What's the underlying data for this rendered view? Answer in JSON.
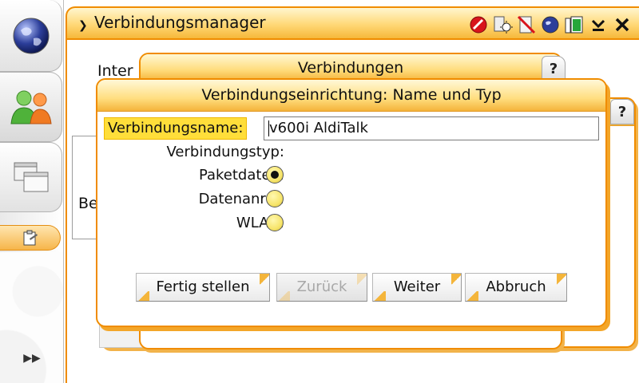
{
  "app": {
    "title": "Verbindungsmanager",
    "partial_label_top": "Inter",
    "partial_label_left": "Be"
  },
  "status_icons": [
    "stop-icon",
    "settings-sun-icon",
    "no-sim-icon",
    "globe-icon",
    "battery-icon"
  ],
  "window_controls": [
    "minimize-icon",
    "close-icon"
  ],
  "sidebar": {
    "items": [
      {
        "icon": "globe-icon"
      },
      {
        "icon": "contacts-icon"
      },
      {
        "icon": "windows-icon"
      },
      {
        "icon": "clipboard-icon"
      }
    ],
    "more_label": "▶▶"
  },
  "background_dialog": {
    "title": "Verbindungen",
    "help_label": "?"
  },
  "dialog": {
    "title": "Verbindungseinrichtung: Name und Typ",
    "name_label": "Verbindungsname:",
    "name_value": "v600i AldiTalk",
    "type_label": "Verbindungstyp:",
    "options": [
      {
        "label": "Paketdaten:",
        "selected": true
      },
      {
        "label": "Datenanruf:",
        "selected": false
      },
      {
        "label": "WLAN:",
        "selected": false
      }
    ],
    "buttons": {
      "finish": "Fertig stellen",
      "back": "Zurück",
      "next": "Weiter",
      "cancel": "Abbruch"
    }
  },
  "colors": {
    "accent_orange": "#f08c00",
    "highlight_yellow": "#ffde3a"
  }
}
